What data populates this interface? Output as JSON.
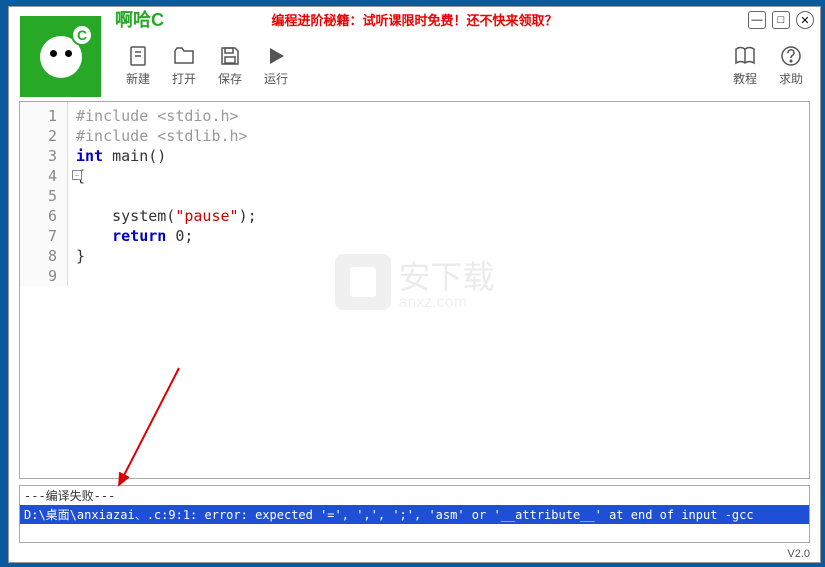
{
  "app": {
    "title": "啊哈C",
    "version": "V2.0"
  },
  "promo": "编程进阶秘籍：试听课限时免费！还不快来领取？",
  "toolbar": {
    "new": "新建",
    "open": "打开",
    "save": "保存",
    "run": "运行",
    "tutorial": "教程",
    "help": "求助"
  },
  "logo": {
    "c": "C"
  },
  "code": {
    "lines": [
      {
        "n": 1,
        "segs": [
          {
            "t": "#include <stdio.h>",
            "c": "c-gray"
          }
        ]
      },
      {
        "n": 2,
        "segs": [
          {
            "t": "#include <stdlib.h>",
            "c": "c-gray"
          }
        ]
      },
      {
        "n": 3,
        "segs": [
          {
            "t": "int",
            "c": "c-blue"
          },
          {
            "t": " main()",
            "c": ""
          }
        ]
      },
      {
        "n": 4,
        "segs": [
          {
            "t": "{",
            "c": ""
          }
        ]
      },
      {
        "n": 5,
        "segs": []
      },
      {
        "n": 6,
        "segs": [
          {
            "t": "    system(",
            "c": ""
          },
          {
            "t": "\"pause\"",
            "c": "c-red"
          },
          {
            "t": ");",
            "c": ""
          }
        ]
      },
      {
        "n": 7,
        "segs": [
          {
            "t": "    ",
            "c": ""
          },
          {
            "t": "return",
            "c": "c-blue"
          },
          {
            "t": " 0;",
            "c": ""
          }
        ]
      },
      {
        "n": 8,
        "segs": [
          {
            "t": "}",
            "c": ""
          }
        ]
      },
      {
        "n": 9,
        "segs": []
      }
    ]
  },
  "output": {
    "header": "---编译失败---",
    "selected": "D:\\桌面\\anxiazai、.c:9:1: error: expected '=', ',', ';', 'asm' or '__attribute__' at end of input -gcc"
  },
  "watermark": {
    "text": "安下载",
    "url": "anxz.com"
  }
}
